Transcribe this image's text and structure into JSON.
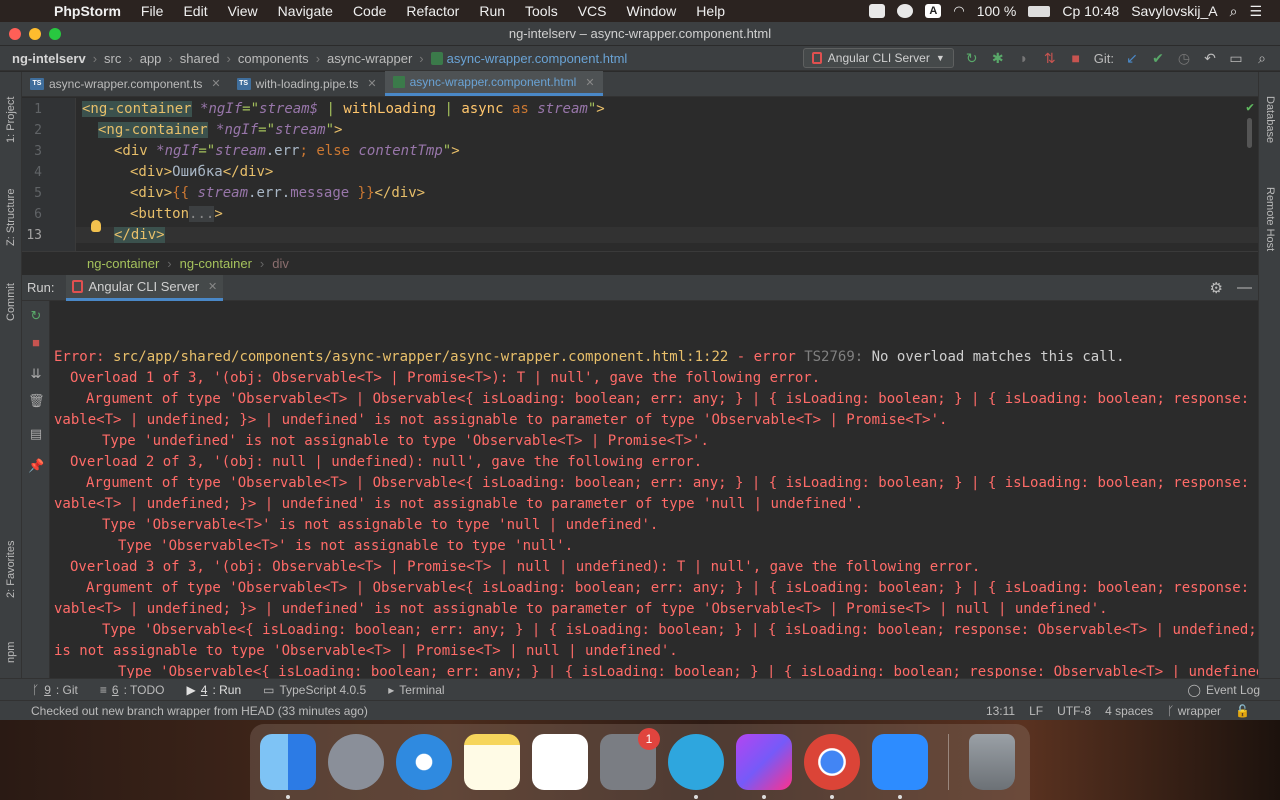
{
  "menubar": {
    "app_name": "PhpStorm",
    "items": [
      "File",
      "Edit",
      "View",
      "Navigate",
      "Code",
      "Refactor",
      "Run",
      "Tools",
      "VCS",
      "Window",
      "Help"
    ],
    "battery": "100 %",
    "clock": "Ср 10:48",
    "user": "Savylovskij_A",
    "input_source": "A"
  },
  "window": {
    "title": "ng-intelserv – async-wrapper.component.html"
  },
  "navbar": {
    "crumbs": [
      "ng-intelserv",
      "src",
      "app",
      "shared",
      "components",
      "async-wrapper"
    ],
    "file": "async-wrapper.component.html",
    "run_config": "Angular CLI Server",
    "git_label": "Git:"
  },
  "tabs": [
    {
      "label": "async-wrapper.component.ts",
      "type": "ts"
    },
    {
      "label": "with-loading.pipe.ts",
      "type": "ts"
    },
    {
      "label": "async-wrapper.component.html",
      "type": "html"
    }
  ],
  "editor": {
    "line_numbers": [
      "1",
      "2",
      "3",
      "4",
      "5",
      "6",
      "13"
    ],
    "breadcrumb": [
      "ng-container",
      "ng-container",
      "div"
    ]
  },
  "side": {
    "left": [
      "1: Project",
      "Z: Structure",
      "Commit",
      "2: Favorites",
      "npm"
    ],
    "right": [
      "Database",
      "Remote Host"
    ]
  },
  "run": {
    "label": "Run:",
    "tab": "Angular CLI Server",
    "console": [
      "Overload 1 of 3, '(obj: Observable<T> | Promise<T>): T | null', gave the following error.",
      "Argument of type 'Observable<T> | Observable<{ isLoading: boolean; err: any; } | { isLoading: boolean; } | { isLoading: boolean; response: Obser",
      "vable<T> | undefined; }> | undefined' is not assignable to parameter of type 'Observable<T> | Promise<T>'.",
      "Type 'undefined' is not assignable to type 'Observable<T> | Promise<T>'.",
      "Overload 2 of 3, '(obj: null | undefined): null', gave the following error.",
      "Argument of type 'Observable<T> | Observable<{ isLoading: boolean; err: any; } | { isLoading: boolean; } | { isLoading: boolean; response: Obser",
      "vable<T> | undefined; }> | undefined' is not assignable to parameter of type 'null | undefined'.",
      "Type 'Observable<T>' is not assignable to type 'null | undefined'.",
      "Type 'Observable<T>' is not assignable to type 'null'.",
      "Overload 3 of 3, '(obj: Observable<T> | Promise<T> | null | undefined): T | null', gave the following error.",
      "Argument of type 'Observable<T> | Observable<{ isLoading: boolean; err: any; } | { isLoading: boolean; } | { isLoading: boolean; response: Obser",
      "vable<T> | undefined; }> | undefined' is not assignable to parameter of type 'Observable<T> | Promise<T> | null | undefined'.",
      "Type 'Observable<{ isLoading: boolean; err: any; } | { isLoading: boolean; } | { isLoading: boolean; response: Observable<T> | undefined; }>'",
      "is not assignable to type 'Observable<T> | Promise<T> | null | undefined'.",
      "Type 'Observable<{ isLoading: boolean; err: any; } | { isLoading: boolean; } | { isLoading: boolean; response: Observable<T> | undefined; }>"
    ],
    "error_line": {
      "prefix": "Error: ",
      "path": "src/app/shared/components/async-wrapper/async-wrapper.component.html",
      "loc": ":1:22",
      "mid": " - error ",
      "code": "TS2769:",
      "msg": " No overload matches this call."
    }
  },
  "tool_tabs": [
    {
      "num": "9",
      "label": ": Git"
    },
    {
      "num": "6",
      "label": ": TODO"
    },
    {
      "num": "4",
      "label": ": Run"
    },
    {
      "num": "",
      "label": "TypeScript 4.0.5"
    },
    {
      "num": "",
      "label": "Terminal"
    }
  ],
  "event_log": "Event Log",
  "status": {
    "message": "Checked out new branch wrapper from HEAD (33 minutes ago)",
    "position": "13:11",
    "line_sep": "LF",
    "encoding": "UTF-8",
    "indent": "4 spaces",
    "branch": "wrapper"
  },
  "dock": {
    "apps": [
      "Finder",
      "Launchpad",
      "Safari",
      "Notes",
      "Numbers",
      "System Preferences",
      "Telegram",
      "PhpStorm",
      "Chrome",
      "Zoom",
      "Trash"
    ],
    "badge": "1"
  }
}
